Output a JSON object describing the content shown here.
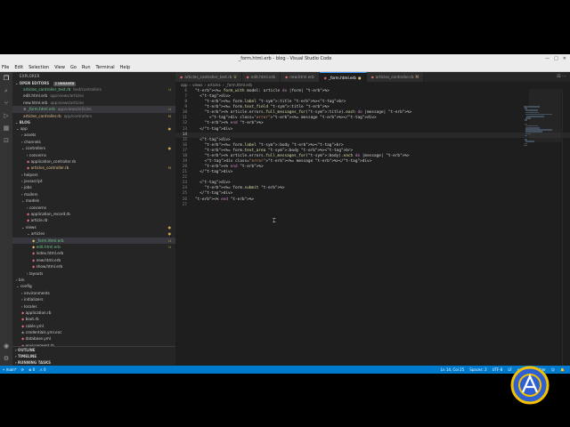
{
  "window": {
    "title": "_form.html.erb - blog - Visual Studio Code",
    "controls": [
      "—",
      "□",
      "✕"
    ]
  },
  "menu": [
    "File",
    "Edit",
    "Selection",
    "View",
    "Go",
    "Run",
    "Terminal",
    "Help"
  ],
  "activity_bar": {
    "icons": [
      "files-icon",
      "search-icon",
      "source-control-icon",
      "run-debug-icon",
      "extensions-icon",
      "remote-icon"
    ],
    "bottom_icons": [
      "account-icon",
      "settings-gear-icon"
    ]
  },
  "sidebar": {
    "title": "EXPLORER",
    "open_editors": {
      "header": "OPEN EDITORS",
      "badge": "1 UNSAVED",
      "items": [
        {
          "name": "articles_controller_test.rb",
          "path": "test/controllers",
          "status": "U"
        },
        {
          "name": "edit.html.erb",
          "path": "app/views/articles",
          "status": ""
        },
        {
          "name": "new.html.erb",
          "path": "app/views/articles",
          "status": ""
        },
        {
          "name": "_form.html.erb",
          "path": "app/views/articles",
          "status": "U"
        },
        {
          "name": "articles_controller.rb",
          "path": "app/controllers",
          "status": "M"
        }
      ]
    },
    "project": {
      "header": "BLOG",
      "tree": [
        {
          "label": "app",
          "depth": 0,
          "kind": "folder-open",
          "status": "●"
        },
        {
          "label": "assets",
          "depth": 1,
          "kind": "folder"
        },
        {
          "label": "channels",
          "depth": 1,
          "kind": "folder"
        },
        {
          "label": "controllers",
          "depth": 1,
          "kind": "folder-open",
          "status": "●"
        },
        {
          "label": "concerns",
          "depth": 2,
          "kind": "folder"
        },
        {
          "label": "application_controller.rb",
          "depth": 2,
          "kind": "file-red"
        },
        {
          "label": "articles_controller.rb",
          "depth": 2,
          "kind": "file-red",
          "status": "M"
        },
        {
          "label": "helpers",
          "depth": 1,
          "kind": "folder"
        },
        {
          "label": "javascript",
          "depth": 1,
          "kind": "folder"
        },
        {
          "label": "jobs",
          "depth": 1,
          "kind": "folder"
        },
        {
          "label": "mailers",
          "depth": 1,
          "kind": "folder"
        },
        {
          "label": "models",
          "depth": 1,
          "kind": "folder-open"
        },
        {
          "label": "concerns",
          "depth": 2,
          "kind": "folder"
        },
        {
          "label": "application_record.rb",
          "depth": 2,
          "kind": "file-red"
        },
        {
          "label": "article.rb",
          "depth": 2,
          "kind": "file-red"
        },
        {
          "label": "views",
          "depth": 1,
          "kind": "folder-open",
          "status": "●"
        },
        {
          "label": "articles",
          "depth": 2,
          "kind": "folder-open",
          "status": "●"
        },
        {
          "label": "_form.html.erb",
          "depth": 3,
          "kind": "file-ylw",
          "status": "U",
          "selected": true
        },
        {
          "label": "edit.html.erb",
          "depth": 3,
          "kind": "file-ylw",
          "status": "U"
        },
        {
          "label": "index.html.erb",
          "depth": 3,
          "kind": "file-red"
        },
        {
          "label": "new.html.erb",
          "depth": 3,
          "kind": "file-red"
        },
        {
          "label": "show.html.erb",
          "depth": 3,
          "kind": "file-red"
        },
        {
          "label": "layouts",
          "depth": 2,
          "kind": "folder"
        },
        {
          "label": "bin",
          "depth": 0,
          "kind": "folder"
        },
        {
          "label": "config",
          "depth": 0,
          "kind": "folder-open"
        },
        {
          "label": "environments",
          "depth": 1,
          "kind": "folder"
        },
        {
          "label": "initializers",
          "depth": 1,
          "kind": "folder"
        },
        {
          "label": "locales",
          "depth": 1,
          "kind": "folder"
        },
        {
          "label": "application.rb",
          "depth": 1,
          "kind": "file-red"
        },
        {
          "label": "boot.rb",
          "depth": 1,
          "kind": "file-red"
        },
        {
          "label": "cable.yml",
          "depth": 1,
          "kind": "file-red"
        },
        {
          "label": "credentials.yml.enc",
          "depth": 1,
          "kind": "file"
        },
        {
          "label": "database.yml",
          "depth": 1,
          "kind": "file-red"
        },
        {
          "label": "environment.rb",
          "depth": 1,
          "kind": "file-red"
        }
      ]
    },
    "bottom_sections": [
      "OUTLINE",
      "TIMELINE",
      "RUNNING TASKS"
    ]
  },
  "tabs": [
    {
      "label": "articles_controller_test.rb",
      "suffix": "U",
      "active": false
    },
    {
      "label": "edit.html.erb",
      "suffix": "",
      "active": false
    },
    {
      "label": "new.html.erb",
      "suffix": "",
      "active": false
    },
    {
      "label": "_form.html.erb",
      "suffix": "●",
      "active": true
    },
    {
      "label": "articles_controller.rb",
      "suffix": "M",
      "active": false
    }
  ],
  "breadcrumbs": [
    "app",
    "views",
    "articles",
    "_form.html.erb"
  ],
  "code": [
    "<%= form_with model: article do |form| %>",
    "  <div>",
    "    <%= form.label :title %><br>",
    "    <%= form.text_field :title %>",
    "    <% article.errors.full_messages_for(:title).each do |message| %>",
    "      <div class=\"error\"><%= message %></div>",
    "    <% end %>",
    "  </div>",
    "",
    "  <div>",
    "    <%= form.label :body %><br>",
    "    <%= form.text_area :body %><br>",
    "    <% article.errors.full_messages_for(:body).each do |message| %>",
    "    <div class=\"error\"><%= message %></div>",
    "    <% end %>",
    "  </div>",
    "",
    "  <div>",
    "    <%= form.submit %>",
    "  </div>",
    "<% end %>",
    ""
  ],
  "code_start_line": 6,
  "current_line": 14,
  "status": {
    "branch": "main*",
    "sync": "⟳",
    "errors": "⊗ 0",
    "warnings": "⚠ 0",
    "position": "Ln 14, Col 25",
    "spaces": "Spaces: 2",
    "encoding": "UTF-8",
    "eol": "LF",
    "language": "erb",
    "prettier": "✓ Prettier",
    "feedback": "☺",
    "bell": "🔔"
  },
  "colors": {
    "status_bar": "#007acc",
    "editor_bg": "#1e1e1e",
    "sidebar_bg": "#252526"
  }
}
